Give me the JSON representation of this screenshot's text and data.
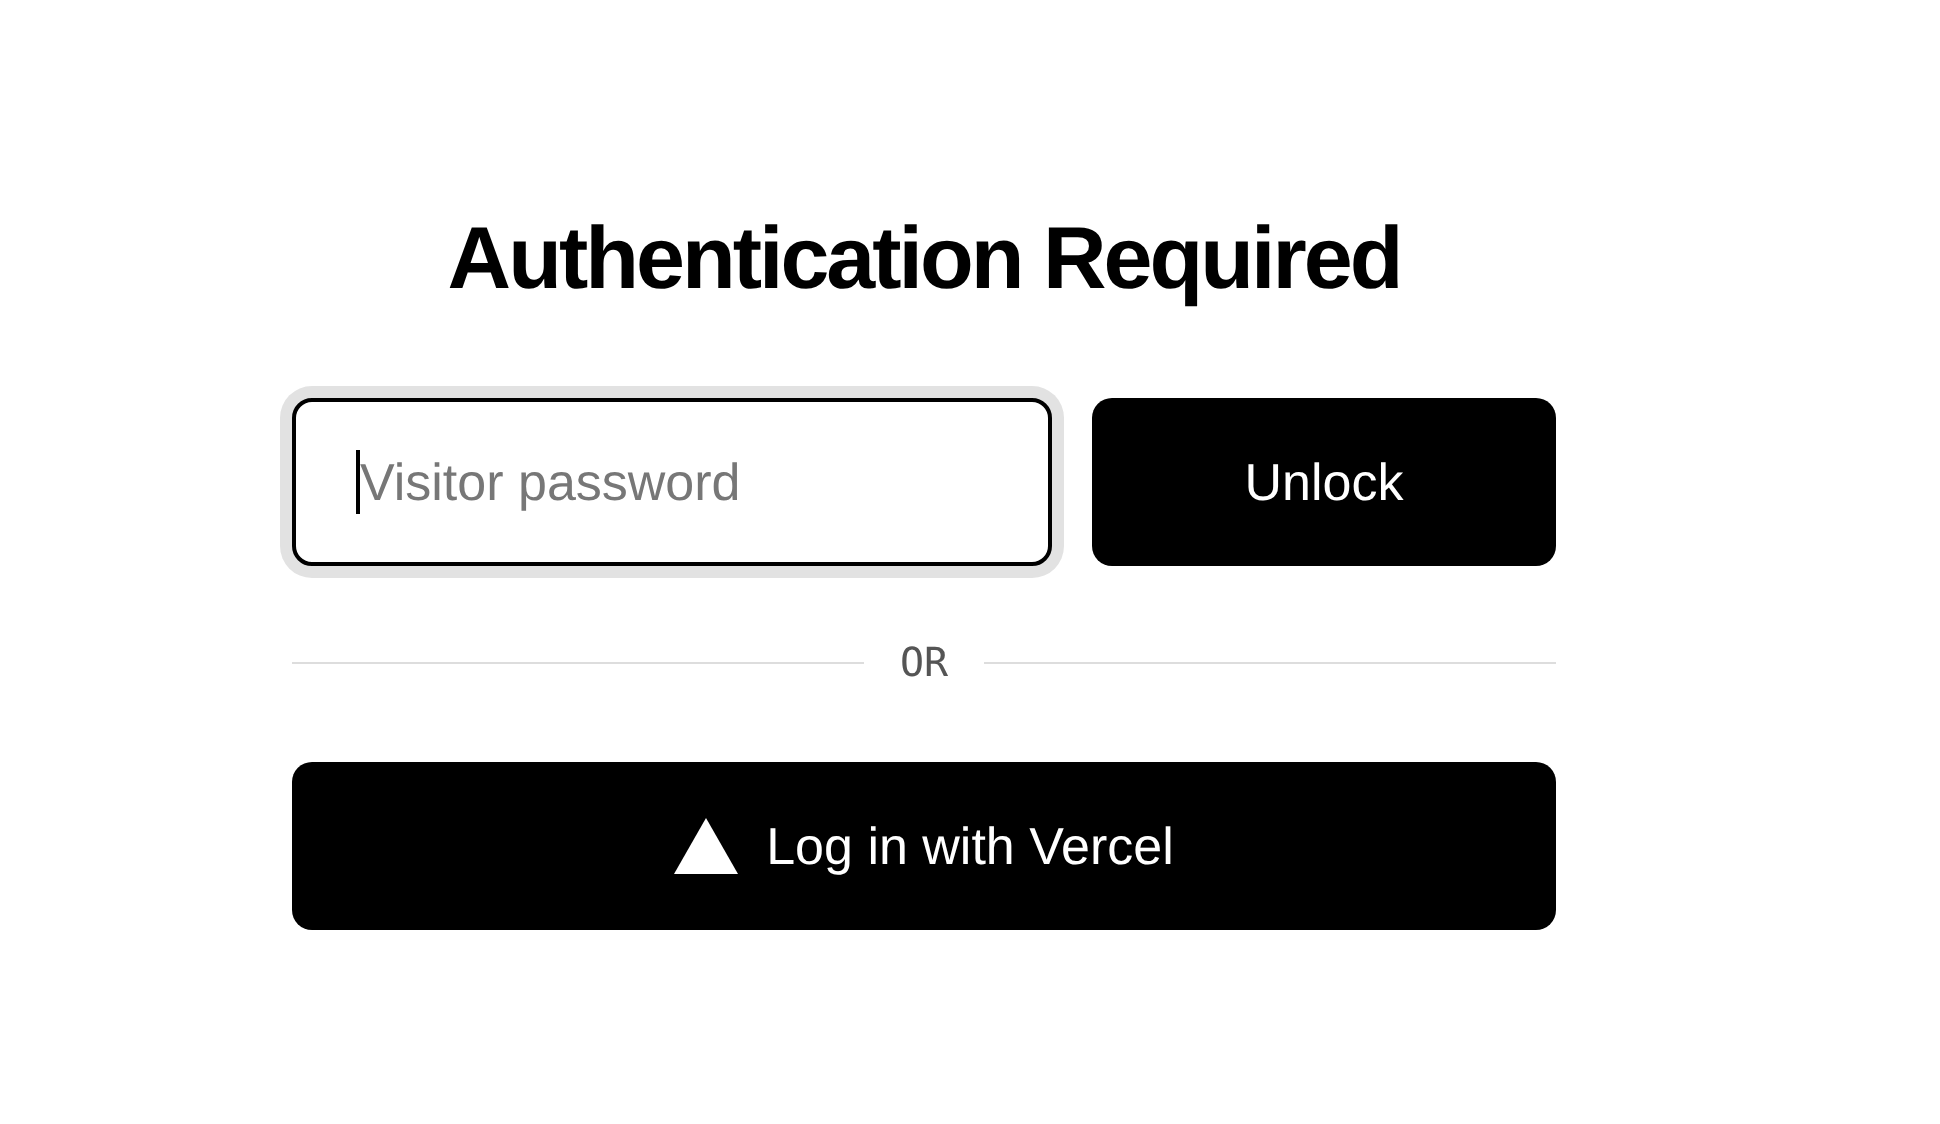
{
  "title": "Authentication Required",
  "password_field": {
    "placeholder": "Visitor password",
    "focused": true
  },
  "unlock_button": {
    "label": "Unlock"
  },
  "divider": {
    "label": "OR"
  },
  "vercel_button": {
    "label": "Log in with Vercel"
  }
}
